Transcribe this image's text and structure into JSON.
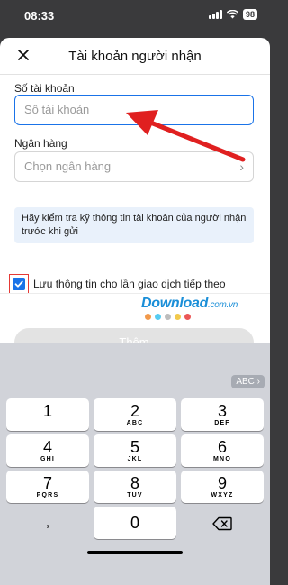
{
  "status_bar": {
    "time": "08:33",
    "battery": "98"
  },
  "sheet": {
    "title": "Tài khoản người nhận",
    "close_icon": "close-icon",
    "account_field": {
      "label": "Số tài khoản",
      "placeholder": "Số tài khoản"
    },
    "bank_field": {
      "label": "Ngân hàng",
      "placeholder": "Chọn ngân hàng"
    },
    "info_text": "Hãy kiểm tra kỹ thông tin tài khoản của người nhận trước khi gửi",
    "save_checkbox": {
      "label": "Lưu thông tin cho lần giao dịch tiếp theo",
      "checked": true
    },
    "submit_button": "Thêm"
  },
  "watermark": {
    "text": "Download",
    "suffix": ".com.vn"
  },
  "keyboard": {
    "abc_button": "ABC",
    "keys": [
      {
        "digit": "1",
        "letters": ""
      },
      {
        "digit": "2",
        "letters": "ABC"
      },
      {
        "digit": "3",
        "letters": "DEF"
      },
      {
        "digit": "4",
        "letters": "GHI"
      },
      {
        "digit": "5",
        "letters": "JKL"
      },
      {
        "digit": "6",
        "letters": "MNO"
      },
      {
        "digit": "7",
        "letters": "PQRS"
      },
      {
        "digit": "8",
        "letters": "TUV"
      },
      {
        "digit": "9",
        "letters": "WXYZ"
      }
    ],
    "comma_key": ",",
    "zero_key": "0",
    "delete_icon": "delete-backspace-icon"
  },
  "colors": {
    "accent": "#1a73e8",
    "info_bg": "#e9f1fb",
    "highlight_red": "#e53935",
    "watermark_blue": "#1b8fd8",
    "disabled_button": "#e3e3e3"
  }
}
